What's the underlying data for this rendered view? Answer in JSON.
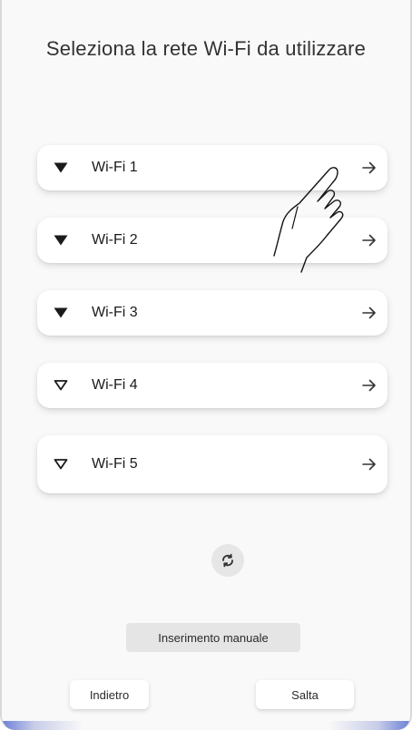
{
  "title": "Seleziona la rete Wi-Fi da utilizzare",
  "networks": [
    {
      "name": "Wi-Fi 1",
      "icon": "wifi-filled-icon"
    },
    {
      "name": "Wi-Fi 2",
      "icon": "wifi-filled-icon"
    },
    {
      "name": "Wi-Fi 3",
      "icon": "wifi-filled-icon"
    },
    {
      "name": "Wi-Fi 4",
      "icon": "wifi-outline-icon"
    },
    {
      "name": "Wi-Fi 5",
      "icon": "wifi-outline-icon"
    }
  ],
  "actions": {
    "refresh_icon": "refresh-icon",
    "manual_label": "Inserimento manuale",
    "back_label": "Indietro",
    "skip_label": "Salta"
  },
  "colors": {
    "background": "#f9f9f9",
    "card": "#ffffff",
    "text": "#1a1a1a",
    "button_gray": "#e5e5e5",
    "accent": "#6b7fd8"
  }
}
